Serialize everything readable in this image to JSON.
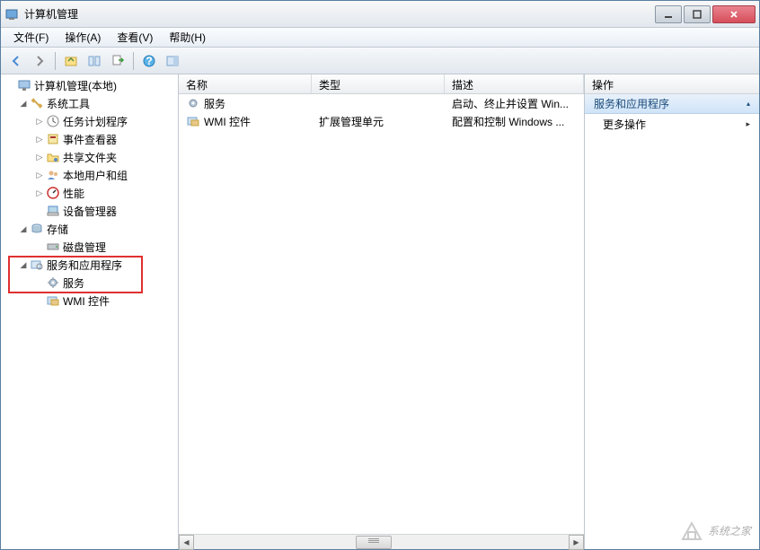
{
  "title": "计算机管理",
  "menu": {
    "file": "文件(F)",
    "action": "操作(A)",
    "view": "查看(V)",
    "help": "帮助(H)"
  },
  "tree": {
    "root": "计算机管理(本地)",
    "system_tools": "系统工具",
    "task_scheduler": "任务计划程序",
    "event_viewer": "事件查看器",
    "shared_folders": "共享文件夹",
    "local_users": "本地用户和组",
    "performance": "性能",
    "device_manager": "设备管理器",
    "storage": "存储",
    "disk_management": "磁盘管理",
    "services_apps": "服务和应用程序",
    "services": "服务",
    "wmi_control": "WMI 控件"
  },
  "list": {
    "headers": {
      "name": "名称",
      "type": "类型",
      "description": "描述"
    },
    "rows": [
      {
        "name": "服务",
        "type": "",
        "description": "启动、终止并设置 Win..."
      },
      {
        "name": "WMI 控件",
        "type": "扩展管理单元",
        "description": "配置和控制 Windows ..."
      }
    ]
  },
  "actions": {
    "header": "操作",
    "section": "服务和应用程序",
    "more": "更多操作"
  },
  "watermark": "系统之家"
}
